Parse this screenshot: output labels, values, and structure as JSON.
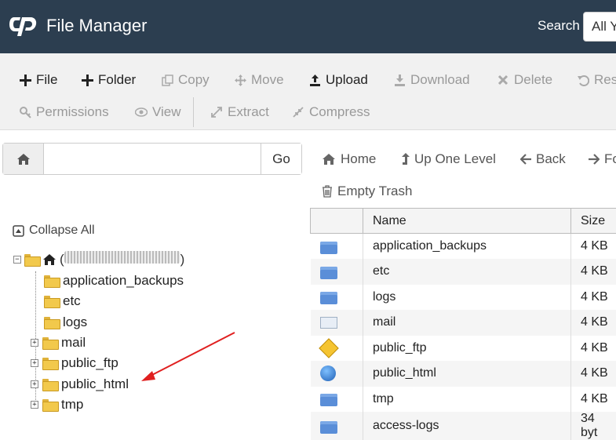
{
  "header": {
    "title": "File Manager",
    "search_label": "Search",
    "search_value": "All Y"
  },
  "toolbar": {
    "row1": [
      {
        "label": "File",
        "icon": "plus-icon",
        "enabled": true
      },
      {
        "label": "Folder",
        "icon": "plus-icon",
        "enabled": true
      },
      {
        "label": "Copy",
        "icon": "copy-icon",
        "enabled": false
      },
      {
        "label": "Move",
        "icon": "move-icon",
        "enabled": false
      },
      {
        "label": "Upload",
        "icon": "upload-icon",
        "enabled": true
      },
      {
        "label": "Download",
        "icon": "download-icon",
        "enabled": false
      },
      {
        "label": "Delete",
        "icon": "close-icon",
        "enabled": false
      },
      {
        "label": "Rest",
        "icon": "restore-icon",
        "enabled": false
      }
    ],
    "row2": [
      {
        "label": "Permissions",
        "icon": "key-icon",
        "enabled": false
      },
      {
        "label": "View",
        "icon": "eye-icon",
        "enabled": false
      },
      {
        "label": "Extract",
        "icon": "expand-icon",
        "enabled": false
      },
      {
        "label": "Compress",
        "icon": "compress-icon",
        "enabled": false
      }
    ]
  },
  "pathbar": {
    "go_label": "Go",
    "value": ""
  },
  "nav": {
    "home": "Home",
    "up": "Up One Level",
    "back": "Back",
    "forward": "Fo",
    "empty_trash": "Empty Trash"
  },
  "tree": {
    "collapse_all": "Collapse All",
    "items": [
      {
        "label": "application_backups",
        "expandable": false
      },
      {
        "label": "etc",
        "expandable": false
      },
      {
        "label": "logs",
        "expandable": false
      },
      {
        "label": "mail",
        "expandable": true
      },
      {
        "label": "public_ftp",
        "expandable": true
      },
      {
        "label": "public_html",
        "expandable": true
      },
      {
        "label": "tmp",
        "expandable": true
      }
    ]
  },
  "table": {
    "headers": [
      "Name",
      "Size"
    ],
    "rows": [
      {
        "icon": "folder-icon",
        "name": "application_backups",
        "size": "4 KB"
      },
      {
        "icon": "folder-icon",
        "name": "etc",
        "size": "4 KB"
      },
      {
        "icon": "folder-icon",
        "name": "logs",
        "size": "4 KB"
      },
      {
        "icon": "mail-icon",
        "name": "mail",
        "size": "4 KB"
      },
      {
        "icon": "ftp-icon",
        "name": "public_ftp",
        "size": "4 KB"
      },
      {
        "icon": "globe-icon",
        "name": "public_html",
        "size": "4 KB"
      },
      {
        "icon": "folder-icon",
        "name": "tmp",
        "size": "4 KB"
      },
      {
        "icon": "folder-icon",
        "name": "access-logs",
        "size": "34 byt"
      }
    ]
  },
  "colors": {
    "header_bg": "#2c3e50",
    "annotation_arrow": "#e02020"
  }
}
